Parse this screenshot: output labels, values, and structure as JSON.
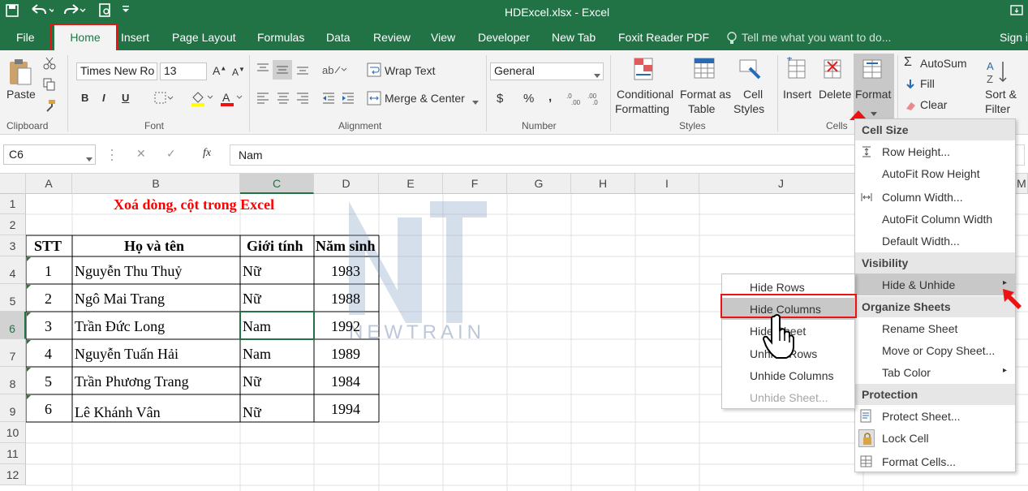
{
  "titlebar": {
    "title": "HDExcel.xlsx - Excel"
  },
  "tabs": [
    "File",
    "Home",
    "Insert",
    "Page Layout",
    "Formulas",
    "Data",
    "Review",
    "View",
    "Developer",
    "New Tab",
    "Foxit Reader PDF"
  ],
  "tellme": "Tell me what you want to do...",
  "signin": "Sign in",
  "clipboard": {
    "paste": "Paste",
    "label": "Clipboard"
  },
  "font": {
    "name": "Times New Ro",
    "size": "13",
    "bold": "B",
    "italic": "I",
    "underline": "U",
    "label": "Font"
  },
  "alignment": {
    "wrap": "Wrap Text",
    "merge": "Merge & Center",
    "label": "Alignment"
  },
  "number": {
    "format": "General",
    "currency": "$",
    "percent": "%",
    "comma": ",",
    "label": "Number"
  },
  "styles": {
    "cond": [
      "Conditional",
      "Formatting"
    ],
    "table": [
      "Format as",
      "Table"
    ],
    "cell": [
      "Cell",
      "Styles"
    ],
    "label": "Styles"
  },
  "cells": {
    "insert": "Insert",
    "delete": "Delete",
    "format": "Format",
    "label": "Cells"
  },
  "editing": {
    "autosum": "AutoSum",
    "fill": "Fill",
    "clear": "Clear",
    "sort": [
      "Sort &",
      "Filter"
    ]
  },
  "formula_bar": {
    "name_box": "C6",
    "content": "Nam",
    "fx": "fx"
  },
  "columns": [
    "A",
    "B",
    "C",
    "D",
    "E",
    "F",
    "G",
    "H",
    "I",
    "J",
    "M"
  ],
  "rows": [
    "1",
    "2",
    "3",
    "4",
    "5",
    "6",
    "7",
    "8",
    "9",
    "10",
    "11",
    "12"
  ],
  "sheet": {
    "title": "Xoá dòng, cột trong Excel",
    "headers": [
      "STT",
      "Họ và tên",
      "Giới tính",
      "Năm sinh"
    ],
    "data": [
      [
        "1",
        "Nguyễn Thu Thuỷ",
        "Nữ",
        "1983"
      ],
      [
        "2",
        "Ngô Mai Trang",
        "Nữ",
        "1988"
      ],
      [
        "3",
        "Trần Đức Long",
        "Nam",
        "1992"
      ],
      [
        "4",
        "Nguyễn Tuấn Hải",
        "Nam",
        "1989"
      ],
      [
        "5",
        "Trần Phương Trang",
        "Nữ",
        "1984"
      ],
      [
        "6",
        "Lê Khánh Vân",
        "Nữ",
        "1994"
      ]
    ]
  },
  "watermark": "NEWTRAIN",
  "format_menu": {
    "cell_size": "Cell Size",
    "row_height": "Row Height...",
    "autofit_row": "AutoFit Row Height",
    "col_width": "Column Width...",
    "autofit_col": "AutoFit Column Width",
    "default_width": "Default Width...",
    "visibility": "Visibility",
    "hide_unhide": "Hide & Unhide",
    "organize": "Organize Sheets",
    "rename": "Rename Sheet",
    "move_copy": "Move or Copy Sheet...",
    "tab_color": "Tab Color",
    "protection": "Protection",
    "protect": "Protect Sheet...",
    "lock": "Lock Cell",
    "format_cells": "Format Cells..."
  },
  "hide_menu": {
    "items": [
      "Hide Rows",
      "Hide Columns",
      "Hide Sheet",
      "Unhide Rows",
      "Unhide Columns",
      "Unhide Sheet..."
    ]
  },
  "colors": {
    "excel_green": "#217346",
    "highlight_red": "#e11111",
    "title_red": "#ff0000"
  }
}
